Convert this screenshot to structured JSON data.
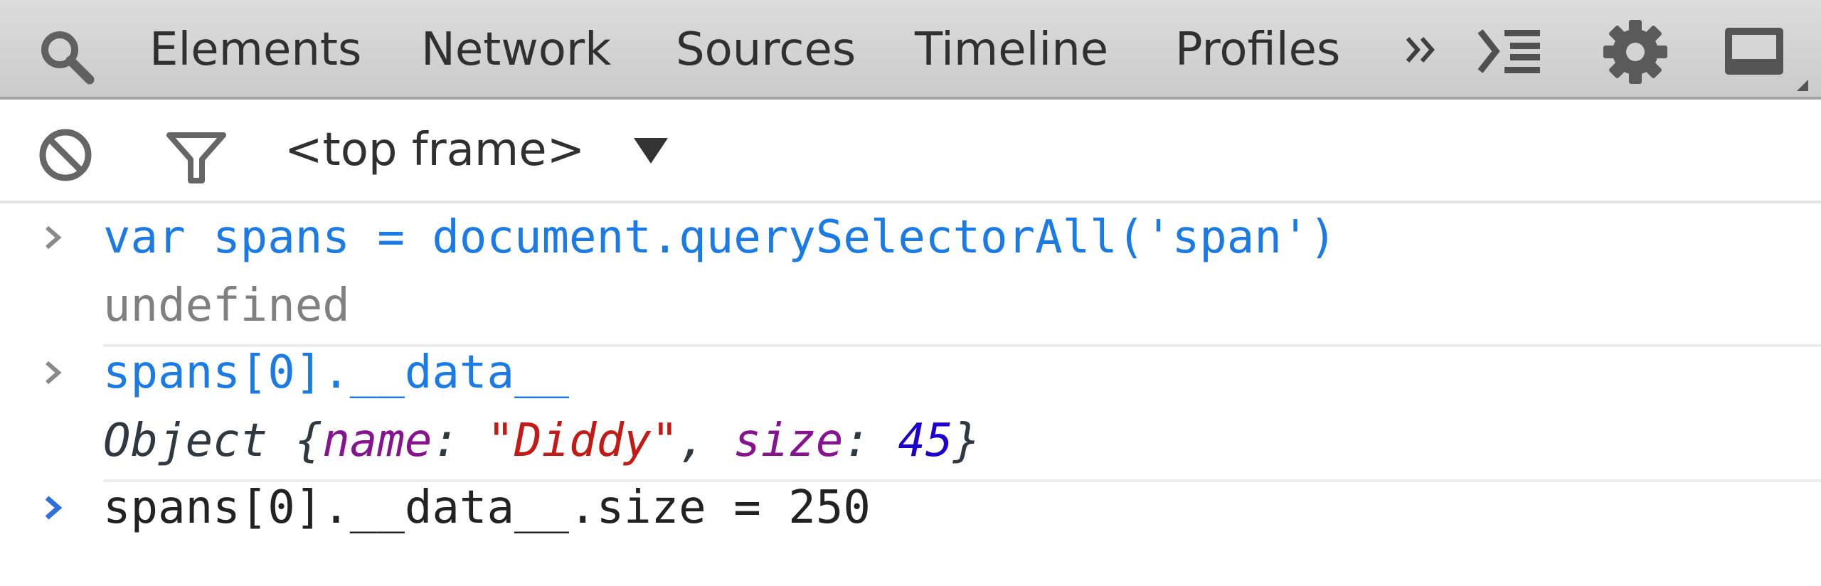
{
  "tabs": [
    {
      "label": "Elements"
    },
    {
      "label": "Network"
    },
    {
      "label": "Sources"
    },
    {
      "label": "Timeline"
    },
    {
      "label": "Profiles"
    }
  ],
  "toolbar": {
    "frame_label": "<top frame>"
  },
  "console": {
    "entries": [
      {
        "input": "var spans = document.querySelectorAll('span')",
        "result": "undefined"
      },
      {
        "input": "spans[0].__data__",
        "result": {
          "prefix": "Object {",
          "k1": "name",
          "sep1": ": ",
          "v1": "\"Diddy\"",
          "comma": ", ",
          "k2": "size",
          "sep2": ": ",
          "v2": "45",
          "suffix": "}"
        }
      }
    ],
    "current_input": "spans[0].__data__.size = 250"
  },
  "colors": {
    "input": "#1a7ae6",
    "undefined": "#808080",
    "property": "#881391",
    "string": "#c41a16",
    "number": "#1c00cf",
    "prompt_active": "#2e6fdc"
  },
  "icons": [
    "search-icon",
    "overflow-chevron-icon",
    "console-drawer-icon",
    "gear-icon",
    "dock-icon",
    "clear-icon",
    "filter-icon",
    "dropdown-triangle-icon",
    "prompt-chevron-icon"
  ]
}
